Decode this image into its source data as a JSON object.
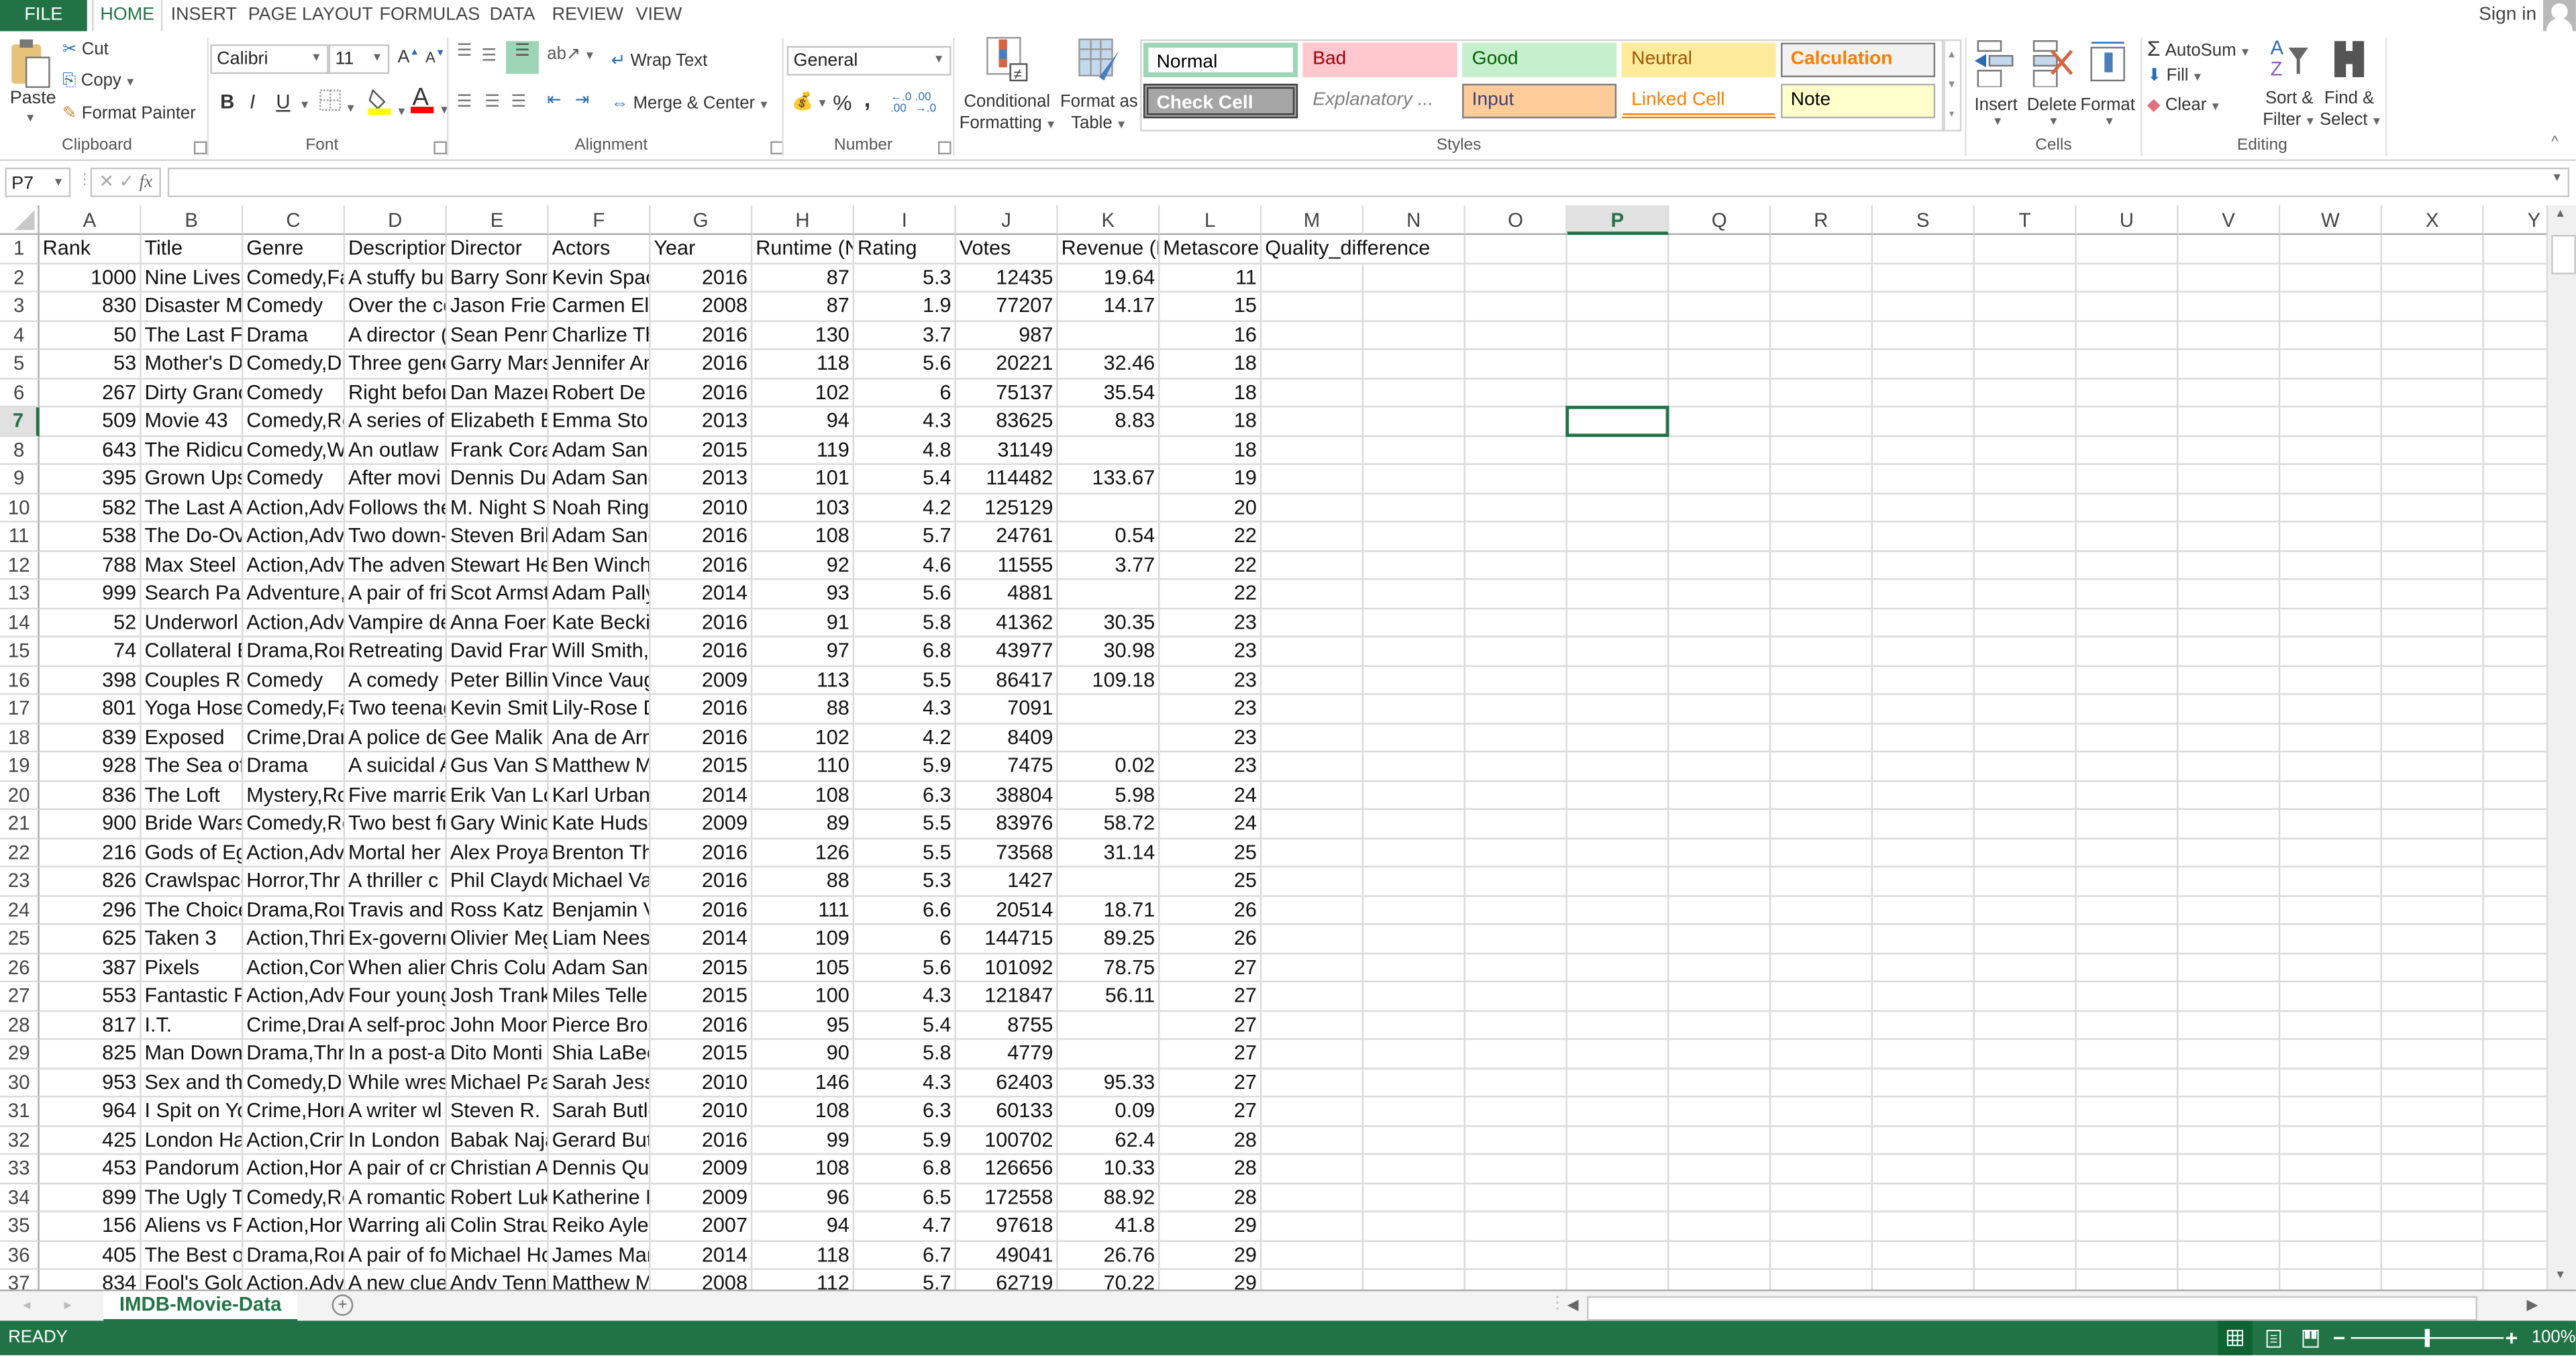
{
  "app": {
    "file_tab": "FILE",
    "tabs": [
      "HOME",
      "INSERT",
      "PAGE LAYOUT",
      "FORMULAS",
      "DATA",
      "REVIEW",
      "VIEW"
    ],
    "active_tab": "HOME",
    "sign_in": "Sign in"
  },
  "ribbon": {
    "clipboard": {
      "label": "Clipboard",
      "paste": "Paste",
      "cut": "Cut",
      "copy": "Copy",
      "format_painter": "Format Painter"
    },
    "font": {
      "label": "Font",
      "font_name": "Calibri",
      "font_size": "11",
      "bold": "B",
      "italic": "I",
      "underline": "U",
      "highlight_color": "#ffff00",
      "font_color": "#ff0000"
    },
    "alignment": {
      "label": "Alignment",
      "wrap_text": "Wrap Text",
      "merge_center": "Merge & Center"
    },
    "number": {
      "label": "Number",
      "format": "General",
      "percent": "%",
      "comma": ","
    },
    "styles": {
      "label": "Styles",
      "conditional_formatting": [
        "Conditional",
        "Formatting"
      ],
      "format_as_table": [
        "Format as",
        "Table"
      ],
      "gallery": [
        {
          "name": "Normal",
          "bg": "#ffffff",
          "fg": "#000000",
          "border": "#9fd5b7"
        },
        {
          "name": "Bad",
          "bg": "#ffc7ce",
          "fg": "#9c0006",
          "border": "#ffc7ce"
        },
        {
          "name": "Good",
          "bg": "#c6efce",
          "fg": "#006100",
          "border": "#c6efce"
        },
        {
          "name": "Neutral",
          "bg": "#ffeb9c",
          "fg": "#9c5700",
          "border": "#ffeb9c"
        },
        {
          "name": "Calculation",
          "bg": "#f2f2f2",
          "fg": "#fa7d00",
          "border": "#7f7f7f"
        },
        {
          "name": "Check Cell",
          "bg": "#a5a5a5",
          "fg": "#ffffff",
          "border": "#3f3f3f"
        },
        {
          "name": "Explanatory ...",
          "bg": "#ffffff",
          "fg": "#7f7f7f",
          "border": "#ffffff"
        },
        {
          "name": "Input",
          "bg": "#ffcc99",
          "fg": "#3f3f76",
          "border": "#7f7f7f"
        },
        {
          "name": "Linked Cell",
          "bg": "#ffffff",
          "fg": "#fa7d00",
          "border": "#ffffff"
        },
        {
          "name": "Note",
          "bg": "#ffffcc",
          "fg": "#000000",
          "border": "#b2b2b2"
        }
      ]
    },
    "cells": {
      "label": "Cells",
      "insert": "Insert",
      "delete": "Delete",
      "format": "Format"
    },
    "editing": {
      "label": "Editing",
      "autosum": "AutoSum",
      "fill": "Fill",
      "clear": "Clear",
      "sort_filter": [
        "Sort &",
        "Filter"
      ],
      "find_select": [
        "Find &",
        "Select"
      ]
    }
  },
  "formula_bar": {
    "name_box": "P7",
    "fx": "fx",
    "value": ""
  },
  "sheet": {
    "columns": [
      "A",
      "B",
      "C",
      "D",
      "E",
      "F",
      "G",
      "H",
      "I",
      "J",
      "K",
      "L",
      "M",
      "N",
      "O",
      "P",
      "Q",
      "R",
      "S",
      "T",
      "U",
      "V",
      "W",
      "X",
      "Y"
    ],
    "selected_column": "P",
    "selected_row": 7,
    "selected_cell": "P7",
    "headers": [
      "Rank",
      "Title",
      "Genre",
      "Description",
      "Director",
      "Actors",
      "Year",
      "Runtime (Minutes)",
      "Rating",
      "Votes",
      "Revenue (Millions)",
      "Metascore",
      "Quality_difference"
    ],
    "header_display": [
      "Rank",
      "Title",
      "Genre",
      "Descriptior",
      "Director",
      "Actors",
      "Year",
      "Runtime (N",
      "Rating",
      "Votes",
      "Revenue (N",
      "Metascore",
      "Quality_difference"
    ],
    "rows": [
      [
        "1000",
        "Nine Lives",
        "Comedy,Fa",
        "A stuffy bu:",
        "Barry Sonn",
        "Kevin Spac",
        "2016",
        "87",
        "5.3",
        "12435",
        "19.64",
        "11"
      ],
      [
        "830",
        "Disaster M",
        "Comedy",
        "Over the cc",
        "Jason Fried",
        "Carmen Ele",
        "2008",
        "87",
        "1.9",
        "77207",
        "14.17",
        "15"
      ],
      [
        "50",
        "The Last Fa",
        "Drama",
        "A director (",
        "Sean Penn",
        "Charlize Th",
        "2016",
        "130",
        "3.7",
        "987",
        "",
        "16"
      ],
      [
        "53",
        "Mother's D",
        "Comedy,Dr",
        "Three gene",
        "Garry Mars",
        "Jennifer An",
        "2016",
        "118",
        "5.6",
        "20221",
        "32.46",
        "18"
      ],
      [
        "267",
        "Dirty Granc",
        "Comedy",
        "Right befor",
        "Dan Mazer",
        "Robert De l",
        "2016",
        "102",
        "6",
        "75137",
        "35.54",
        "18"
      ],
      [
        "509",
        "Movie 43",
        "Comedy,Rc",
        "A series of",
        "Elizabeth B",
        "Emma Stor",
        "2013",
        "94",
        "4.3",
        "83625",
        "8.83",
        "18"
      ],
      [
        "643",
        "The Ridicul",
        "Comedy,W",
        "An outlaw",
        "Frank Cora",
        "Adam Sand",
        "2015",
        "119",
        "4.8",
        "31149",
        "",
        "18"
      ],
      [
        "395",
        "Grown Ups",
        "Comedy",
        "After movi",
        "Dennis Dug",
        "Adam Sand",
        "2013",
        "101",
        "5.4",
        "114482",
        "133.67",
        "19"
      ],
      [
        "582",
        "The Last Ai",
        "Action,Adv",
        "Follows the",
        "M. Night Sh",
        "Noah Ringe",
        "2010",
        "103",
        "4.2",
        "125129",
        "",
        "20"
      ],
      [
        "538",
        "The Do-Ove",
        "Action,Adv",
        "Two down-",
        "Steven Bril",
        "Adam Sand",
        "2016",
        "108",
        "5.7",
        "24761",
        "0.54",
        "22"
      ],
      [
        "788",
        "Max Steel",
        "Action,Adv",
        "The advent",
        "Stewart He",
        "Ben Winch",
        "2016",
        "92",
        "4.6",
        "11555",
        "3.77",
        "22"
      ],
      [
        "999",
        "Search Part",
        "Adventure,",
        "A pair of fri",
        "Scot Armst",
        "Adam Pally",
        "2014",
        "93",
        "5.6",
        "4881",
        "",
        "22"
      ],
      [
        "52",
        "Underworl",
        "Action,Adv",
        "Vampire de",
        "Anna Foers",
        "Kate Beckir",
        "2016",
        "91",
        "5.8",
        "41362",
        "30.35",
        "23"
      ],
      [
        "74",
        "Collateral E",
        "Drama,Ron",
        "Retreating",
        "David Fran",
        "Will Smith,",
        "2016",
        "97",
        "6.8",
        "43977",
        "30.98",
        "23"
      ],
      [
        "398",
        "Couples Re",
        "Comedy",
        "A comedy c",
        "Peter Billin",
        "Vince Vaug",
        "2009",
        "113",
        "5.5",
        "86417",
        "109.18",
        "23"
      ],
      [
        "801",
        "Yoga Hoser",
        "Comedy,Fa",
        "Two teenag",
        "Kevin Smitl",
        "Lily-Rose D",
        "2016",
        "88",
        "4.3",
        "7091",
        "",
        "23"
      ],
      [
        "839",
        "Exposed",
        "Crime,Drar",
        "A police de",
        "Gee Malik",
        "Ana de Arm",
        "2016",
        "102",
        "4.2",
        "8409",
        "",
        "23"
      ],
      [
        "928",
        "The Sea of",
        "Drama",
        "A suicidal A",
        "Gus Van Sa",
        "Matthew M",
        "2015",
        "110",
        "5.9",
        "7475",
        "0.02",
        "23"
      ],
      [
        "836",
        "The Loft",
        "Mystery,Rc",
        "Five marrie",
        "Erik Van Lo",
        "Karl Urban,",
        "2014",
        "108",
        "6.3",
        "38804",
        "5.98",
        "24"
      ],
      [
        "900",
        "Bride Wars",
        "Comedy,Rc",
        "Two best fr",
        "Gary Winic",
        "Kate Hudsc",
        "2009",
        "89",
        "5.5",
        "83976",
        "58.72",
        "24"
      ],
      [
        "216",
        "Gods of Eg",
        "Action,Adv",
        "Mortal her",
        "Alex Proyas",
        "Brenton Th",
        "2016",
        "126",
        "5.5",
        "73568",
        "31.14",
        "25"
      ],
      [
        "826",
        "Crawlspace",
        "Horror,Thr",
        "A thriller c",
        "Phil Claydo",
        "Michael Va",
        "2016",
        "88",
        "5.3",
        "1427",
        "",
        "25"
      ],
      [
        "296",
        "The Choice",
        "Drama,Ron",
        "Travis and",
        "Ross Katz",
        "Benjamin V",
        "2016",
        "111",
        "6.6",
        "20514",
        "18.71",
        "26"
      ],
      [
        "625",
        "Taken 3",
        "Action,Thri",
        "Ex-governn",
        "Olivier Meg",
        "Liam Neesc",
        "2014",
        "109",
        "6",
        "144715",
        "89.25",
        "26"
      ],
      [
        "387",
        "Pixels",
        "Action,Com",
        "When alier",
        "Chris Colur",
        "Adam Sand",
        "2015",
        "105",
        "5.6",
        "101092",
        "78.75",
        "27"
      ],
      [
        "553",
        "Fantastic F",
        "Action,Adv",
        "Four young",
        "Josh Trank",
        "Miles Telle",
        "2015",
        "100",
        "4.3",
        "121847",
        "56.11",
        "27"
      ],
      [
        "817",
        "I.T.",
        "Crime,Drar",
        "A self-proc",
        "John Moor",
        "Pierce Bros",
        "2016",
        "95",
        "5.4",
        "8755",
        "",
        "27"
      ],
      [
        "825",
        "Man Down",
        "Drama,Thri",
        "In a post-a",
        "Dito Monti",
        "Shia LaBeo",
        "2015",
        "90",
        "5.8",
        "4779",
        "",
        "27"
      ],
      [
        "953",
        "Sex and the",
        "Comedy,Dr",
        "While wres",
        "Michael Pa",
        "Sarah Jessi",
        "2010",
        "146",
        "4.3",
        "62403",
        "95.33",
        "27"
      ],
      [
        "964",
        "I Spit on Yo",
        "Crime,Horr",
        "A writer wl",
        "Steven R. N",
        "Sarah Butle",
        "2010",
        "108",
        "6.3",
        "60133",
        "0.09",
        "27"
      ],
      [
        "425",
        "London Ha",
        "Action,Crin",
        "In London f",
        "Babak Naja",
        "Gerard But",
        "2016",
        "99",
        "5.9",
        "100702",
        "62.4",
        "28"
      ],
      [
        "453",
        "Pandorum",
        "Action,Hor",
        "A pair of cr",
        "Christian A",
        "Dennis Qua",
        "2009",
        "108",
        "6.8",
        "126656",
        "10.33",
        "28"
      ],
      [
        "899",
        "The Ugly Tr",
        "Comedy,Rc",
        "A romantic",
        "Robert Luk",
        "Katherine H",
        "2009",
        "96",
        "6.5",
        "172558",
        "88.92",
        "28"
      ],
      [
        "156",
        "Aliens vs Pr",
        "Action,Hor",
        "Warring ali",
        "Colin Strau",
        "Reiko Ayles",
        "2007",
        "94",
        "4.7",
        "97618",
        "41.8",
        "29"
      ],
      [
        "405",
        "The Best of",
        "Drama,Ron",
        "A pair of fo",
        "Michael Hc",
        "James Mar",
        "2014",
        "118",
        "6.7",
        "49041",
        "26.76",
        "29"
      ],
      [
        "834",
        "Fool's Gold",
        "Action,Adv",
        "A new clue",
        "Andy Tenn",
        "Matthew M",
        "2008",
        "112",
        "5.7",
        "62719",
        "70.22",
        "29"
      ]
    ]
  },
  "sheet_tabs": {
    "active": "IMDB-Movie-Data"
  },
  "status_bar": {
    "status": "READY",
    "zoom": "100%",
    "zoom_level_percent": 100
  }
}
